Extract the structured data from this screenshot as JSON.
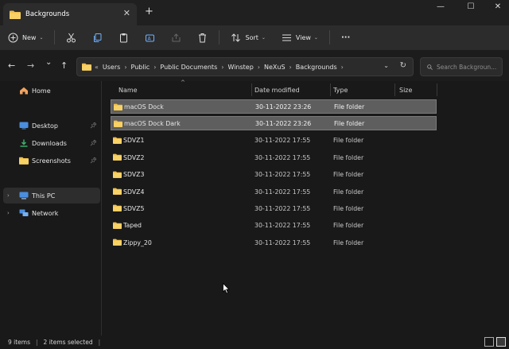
{
  "window": {
    "tab_title": "Backgrounds",
    "close_tab": "✕",
    "new_tab": "+",
    "minimize": "—",
    "maximize": "☐",
    "close": "✕"
  },
  "commandbar": {
    "new_label": "New"
  },
  "toolbar": {
    "sort_label": "Sort",
    "view_label": "View",
    "more_label": "···"
  },
  "nav": {
    "back": "←",
    "forward": "→",
    "recent": "⌄",
    "up": "↑"
  },
  "address": {
    "overflow": "«",
    "crumbs": [
      "Users",
      "Public",
      "Public Documents",
      "Winstep",
      "NeXuS",
      "Backgrounds"
    ]
  },
  "search": {
    "placeholder": "Search Backgroun..."
  },
  "sidebar": {
    "items": [
      {
        "label": "Home"
      },
      {
        "label": "Desktop"
      },
      {
        "label": "Downloads"
      },
      {
        "label": "Screenshots"
      },
      {
        "label": "This PC"
      },
      {
        "label": "Network"
      }
    ]
  },
  "columns": {
    "name": "Name",
    "date_modified": "Date modified",
    "type": "Type",
    "size": "Size"
  },
  "files": [
    {
      "name": "macOS Dock",
      "date": "30-11-2022 23:26",
      "type": "File folder",
      "selected": true
    },
    {
      "name": "macOS Dock Dark",
      "date": "30-11-2022 23:26",
      "type": "File folder",
      "selected": true
    },
    {
      "name": "SDVZ1",
      "date": "30-11-2022 17:55",
      "type": "File folder",
      "selected": false
    },
    {
      "name": "SDVZ2",
      "date": "30-11-2022 17:55",
      "type": "File folder",
      "selected": false
    },
    {
      "name": "SDVZ3",
      "date": "30-11-2022 17:55",
      "type": "File folder",
      "selected": false
    },
    {
      "name": "SDVZ4",
      "date": "30-11-2022 17:55",
      "type": "File folder",
      "selected": false
    },
    {
      "name": "SDVZ5",
      "date": "30-11-2022 17:55",
      "type": "File folder",
      "selected": false
    },
    {
      "name": "Taped",
      "date": "30-11-2022 17:55",
      "type": "File folder",
      "selected": false
    },
    {
      "name": "Zippy_20",
      "date": "30-11-2022 17:55",
      "type": "File folder",
      "selected": false
    }
  ],
  "status": {
    "item_count": "9 items",
    "selection": "2 items selected"
  },
  "colors": {
    "folder": "#f2c14e",
    "selection": "#5e5e5e",
    "background": "#191919"
  }
}
